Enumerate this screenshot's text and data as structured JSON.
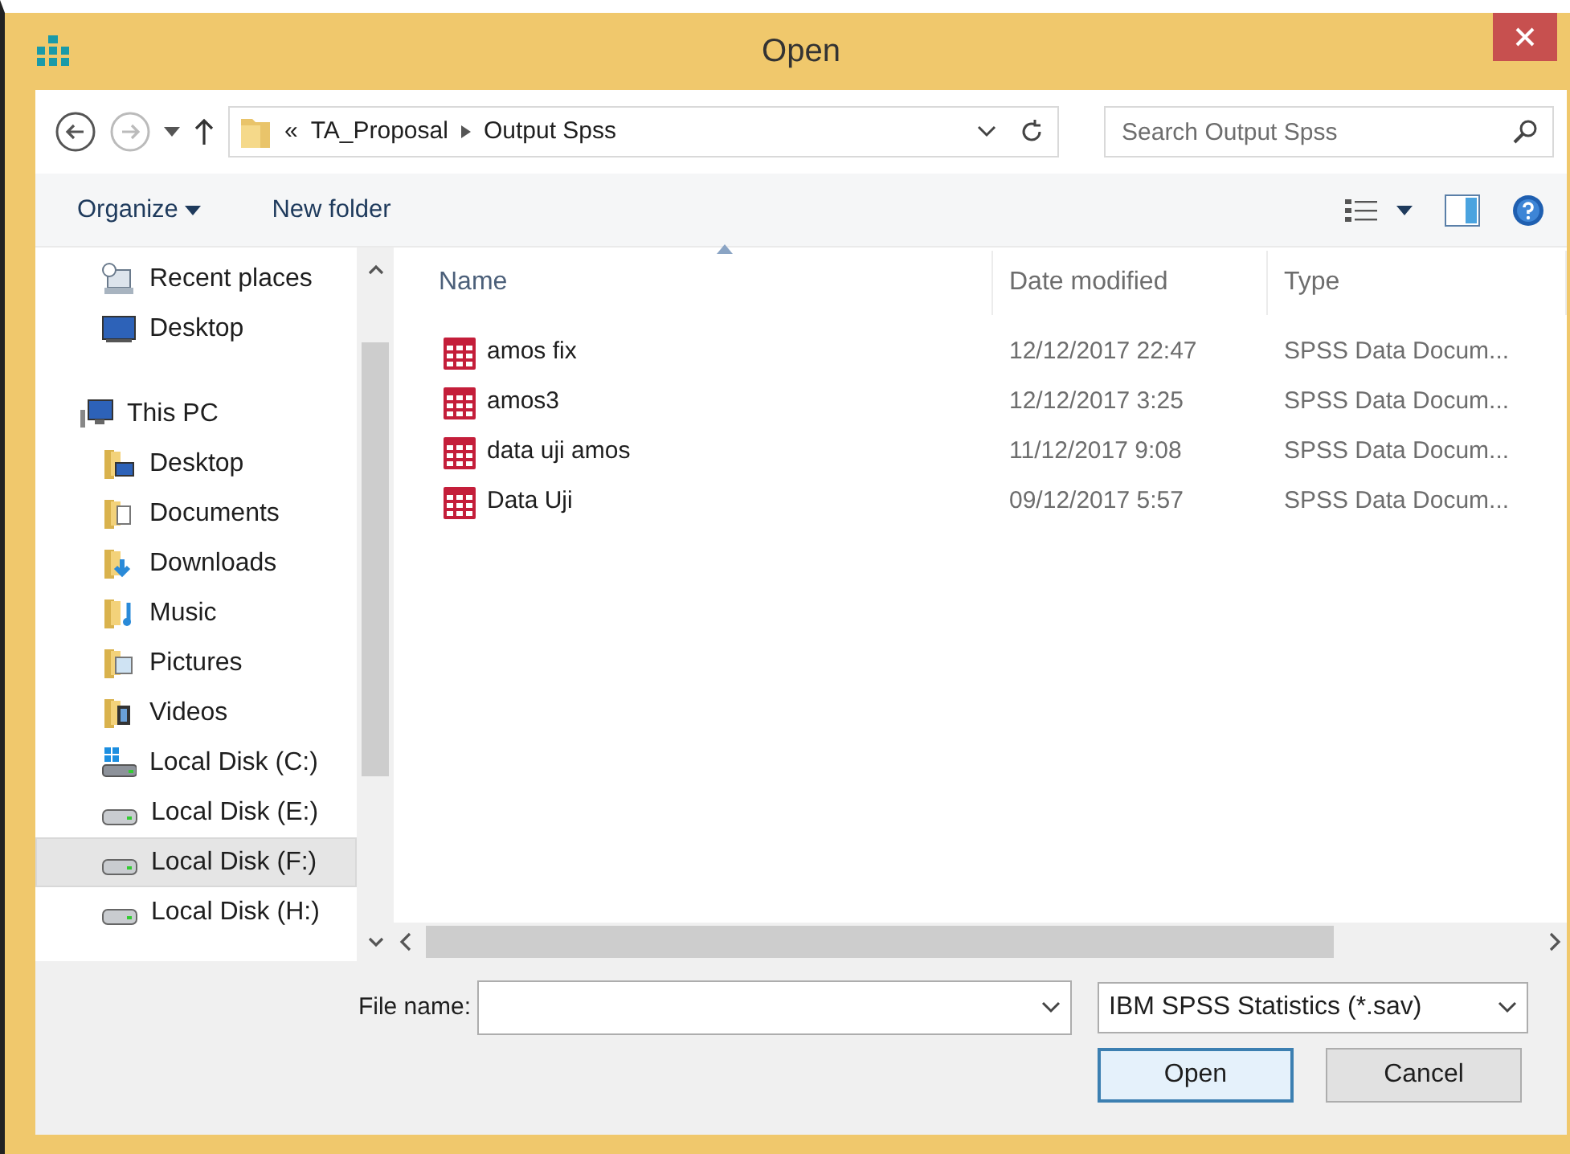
{
  "window": {
    "title": "Open"
  },
  "address_bar": {
    "overflow": "«",
    "path": [
      "TA_Proposal",
      "Output Spss"
    ]
  },
  "search": {
    "placeholder": "Search Output Spss"
  },
  "toolbar": {
    "organize": "Organize",
    "new_folder": "New folder"
  },
  "sidebar": {
    "favorites": [
      {
        "label": "Recent places",
        "kind": "recent",
        "selected": false
      },
      {
        "label": "Desktop",
        "kind": "monitor",
        "selected": false
      }
    ],
    "this_pc": {
      "label": "This PC",
      "kind": "computer",
      "selected": false,
      "children": [
        {
          "label": "Desktop",
          "kind": "desktop",
          "selected": false
        },
        {
          "label": "Documents",
          "kind": "documents",
          "selected": false
        },
        {
          "label": "Downloads",
          "kind": "downloads",
          "selected": false
        },
        {
          "label": "Music",
          "kind": "music",
          "selected": false
        },
        {
          "label": "Pictures",
          "kind": "pictures",
          "selected": false
        },
        {
          "label": "Videos",
          "kind": "videos",
          "selected": false
        },
        {
          "label": "Local Disk (C:)",
          "kind": "system",
          "selected": false
        },
        {
          "label": "Local Disk (E:)",
          "kind": "drive",
          "selected": false
        },
        {
          "label": "Local Disk (F:)",
          "kind": "drive",
          "selected": true
        },
        {
          "label": "Local Disk (H:)",
          "kind": "drive",
          "selected": false
        }
      ]
    }
  },
  "table": {
    "columns": [
      "Name",
      "Date modified",
      "Type"
    ],
    "rows": [
      {
        "name": "amos fix",
        "date": "12/12/2017 22:47",
        "type": "SPSS Data Docum..."
      },
      {
        "name": "amos3",
        "date": "12/12/2017 3:25",
        "type": "SPSS Data Docum..."
      },
      {
        "name": "data uji amos",
        "date": "11/12/2017 9:08",
        "type": "SPSS Data Docum..."
      },
      {
        "name": "Data Uji",
        "date": "09/12/2017 5:57",
        "type": "SPSS Data Docum..."
      }
    ]
  },
  "file_name": {
    "label": "File name:"
  },
  "file_type": {
    "value": "IBM SPSS Statistics (*.sav)"
  },
  "buttons": [
    {
      "label": "Open",
      "kind": "default"
    },
    {
      "label": "Cancel",
      "kind": "normal"
    }
  ]
}
